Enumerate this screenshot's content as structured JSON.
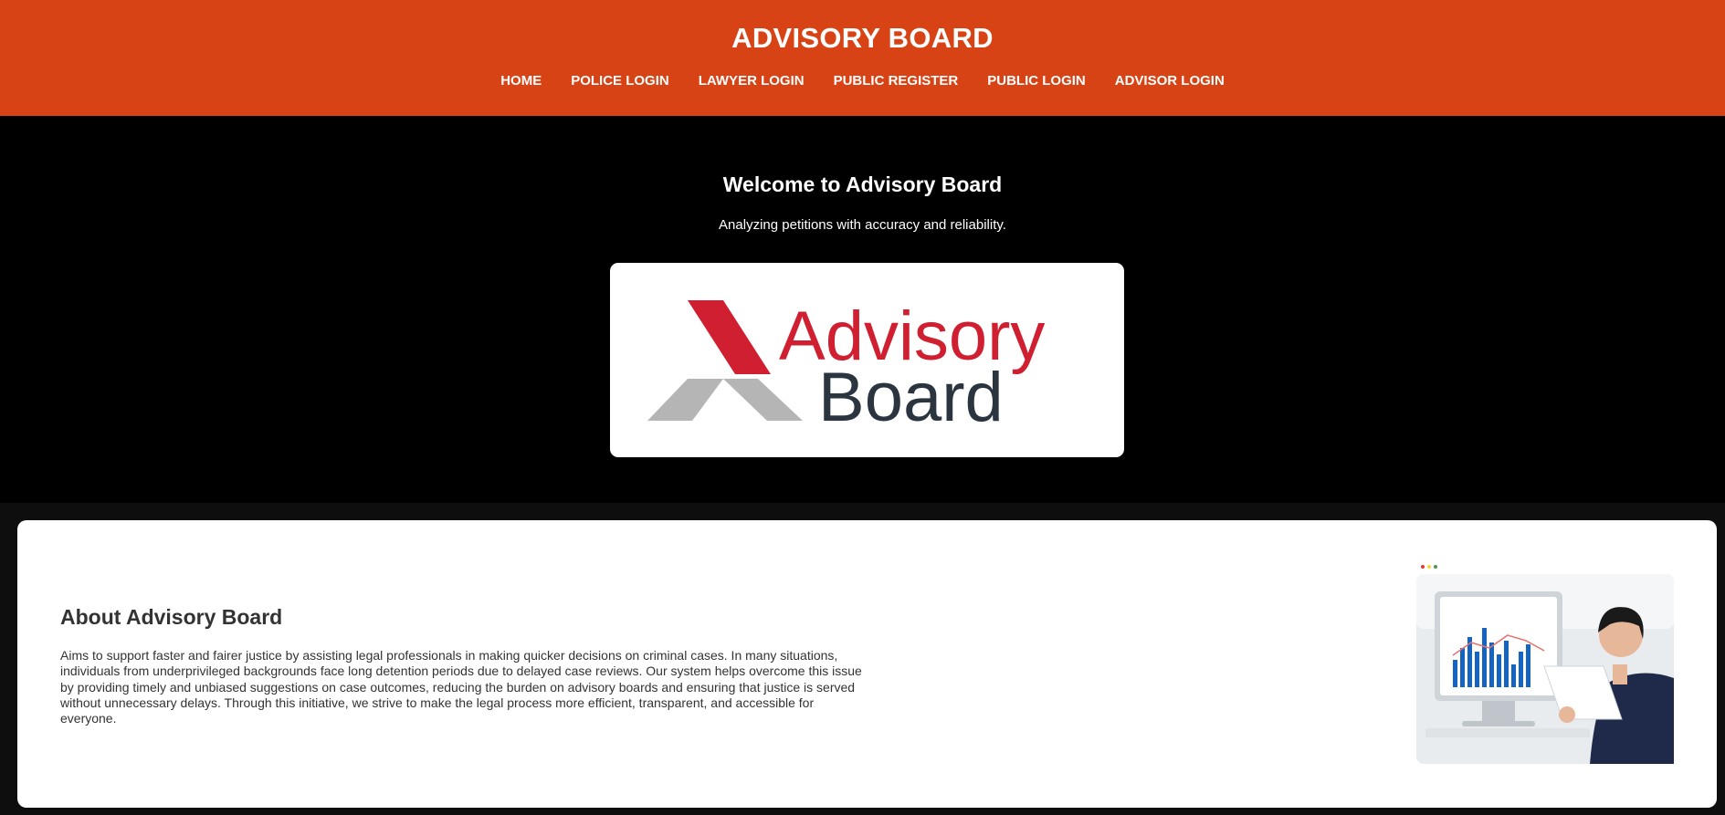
{
  "header": {
    "title": "ADVISORY BOARD",
    "nav": [
      "HOME",
      "POLICE LOGIN",
      "LAWYER LOGIN",
      "PUBLIC REGISTER",
      "PUBLIC LOGIN",
      "ADVISOR LOGIN"
    ]
  },
  "hero": {
    "title": "Welcome to Advisory Board",
    "subtitle": "Analyzing petitions with accuracy and reliability.",
    "logo": {
      "word1": "Advisory",
      "word2": "Board"
    }
  },
  "about": {
    "title": "About Advisory Board",
    "text": "Aims to support faster and fairer justice by assisting legal professionals in making quicker decisions on criminal cases. In many situations, individuals from underprivileged backgrounds face long detention periods due to delayed case reviews. Our system helps overcome this issue by providing timely and unbiased suggestions on case outcomes, reducing the burden on advisory boards and ensuring that justice is served without unnecessary delays. Through this initiative, we strive to make the legal process more efficient, transparent, and accessible for everyone."
  },
  "colors": {
    "header": "#d84315",
    "hero": "#000000",
    "logo_red": "#d01f30",
    "logo_gray": "#b5b5b5",
    "logo_dark": "#2b3540"
  }
}
